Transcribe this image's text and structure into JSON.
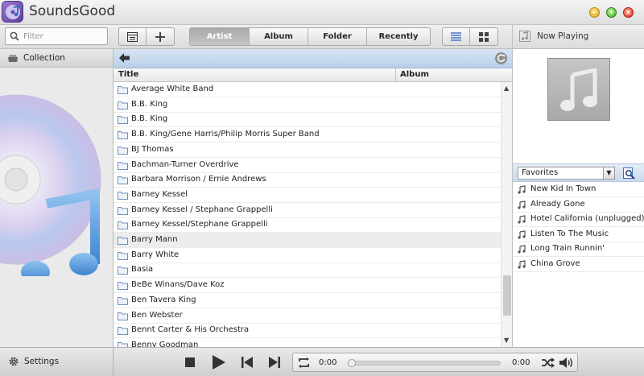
{
  "app": {
    "title": "SoundsGood"
  },
  "window": {
    "minimize_icon": "minus",
    "maximize_icon": "plus",
    "close_icon": "x"
  },
  "toolbar": {
    "filter_placeholder": "Filter",
    "tabs": [
      {
        "label": "Artist",
        "active": true
      },
      {
        "label": "Album",
        "active": false
      },
      {
        "label": "Folder",
        "active": false
      },
      {
        "label": "Recently",
        "active": false
      }
    ]
  },
  "sidebar": {
    "collection_label": "Collection",
    "settings_label": "Settings"
  },
  "list": {
    "columns": {
      "title": "Title",
      "album": "Album"
    },
    "rows": [
      {
        "title": "Average White Band"
      },
      {
        "title": "B.B. King"
      },
      {
        "title": "B.B. King"
      },
      {
        "title": "B.B. King/Gene Harris/Philip Morris Super Band"
      },
      {
        "title": "BJ Thomas"
      },
      {
        "title": "Bachman-Turner Overdrive"
      },
      {
        "title": "Barbara Morrison / Ernie Andrews"
      },
      {
        "title": "Barney Kessel"
      },
      {
        "title": "Barney Kessel / Stephane Grappelli"
      },
      {
        "title": "Barney Kessel/Stephane Grappelli"
      },
      {
        "title": "Barry Mann",
        "highlighted": true
      },
      {
        "title": "Barry White"
      },
      {
        "title": "Basia"
      },
      {
        "title": "BeBe Winans/Dave Koz"
      },
      {
        "title": "Ben Tavera King"
      },
      {
        "title": "Ben Webster"
      },
      {
        "title": "Bennt Carter & His Orchestra"
      },
      {
        "title": "Benny Goodman"
      }
    ]
  },
  "now_playing": {
    "header": "Now Playing",
    "playlist_select": "Favorites",
    "tracks": [
      "New Kid In Town",
      "Already Gone",
      "Hotel California (unplugged)",
      "Listen To The Music",
      "Long Train Runnin'",
      "China Grove"
    ]
  },
  "player": {
    "elapsed": "0:00",
    "remaining": "0:00",
    "progress": 0
  }
}
